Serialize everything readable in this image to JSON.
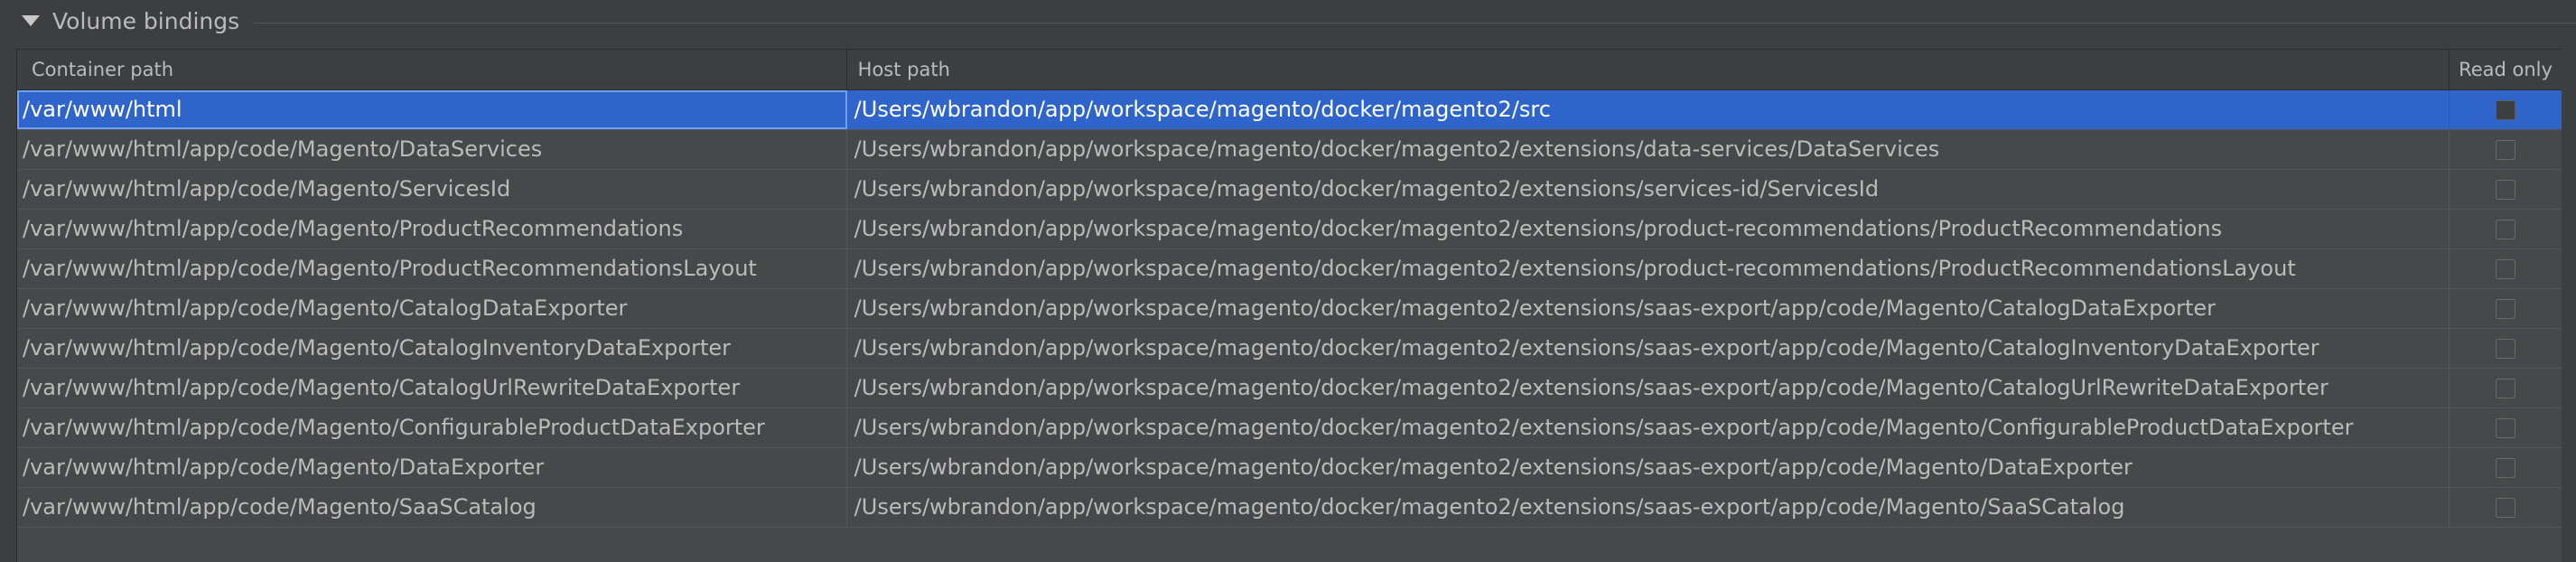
{
  "section": {
    "title": "Volume bindings",
    "toggle_icon": "triangle-down-icon"
  },
  "table": {
    "headers": {
      "container_path": "Container path",
      "host_path": "Host path",
      "read_only": "Read only"
    },
    "rows": [
      {
        "container": "/var/www/html",
        "host": "/Users/wbrandon/app/workspace/magento/docker/magento2/src",
        "read_only": false,
        "selected": true
      },
      {
        "container": "/var/www/html/app/code/Magento/DataServices",
        "host": "/Users/wbrandon/app/workspace/magento/docker/magento2/extensions/data-services/DataServices",
        "read_only": false
      },
      {
        "container": "/var/www/html/app/code/Magento/ServicesId",
        "host": "/Users/wbrandon/app/workspace/magento/docker/magento2/extensions/services-id/ServicesId",
        "read_only": false
      },
      {
        "container": "/var/www/html/app/code/Magento/ProductRecommendations",
        "host": "/Users/wbrandon/app/workspace/magento/docker/magento2/extensions/product-recommendations/ProductRecommendations",
        "read_only": false
      },
      {
        "container": "/var/www/html/app/code/Magento/ProductRecommendationsLayout",
        "host": "/Users/wbrandon/app/workspace/magento/docker/magento2/extensions/product-recommendations/ProductRecommendationsLayout",
        "read_only": false
      },
      {
        "container": "/var/www/html/app/code/Magento/CatalogDataExporter",
        "host": "/Users/wbrandon/app/workspace/magento/docker/magento2/extensions/saas-export/app/code/Magento/CatalogDataExporter",
        "read_only": false
      },
      {
        "container": "/var/www/html/app/code/Magento/CatalogInventoryDataExporter",
        "host": "/Users/wbrandon/app/workspace/magento/docker/magento2/extensions/saas-export/app/code/Magento/CatalogInventoryDataExporter",
        "read_only": false
      },
      {
        "container": "/var/www/html/app/code/Magento/CatalogUrlRewriteDataExporter",
        "host": "/Users/wbrandon/app/workspace/magento/docker/magento2/extensions/saas-export/app/code/Magento/CatalogUrlRewriteDataExporter",
        "read_only": false
      },
      {
        "container": "/var/www/html/app/code/Magento/ConfigurableProductDataExporter",
        "host": "/Users/wbrandon/app/workspace/magento/docker/magento2/extensions/saas-export/app/code/Magento/ConfigurableProductDataExporter",
        "read_only": false
      },
      {
        "container": "/var/www/html/app/code/Magento/DataExporter",
        "host": "/Users/wbrandon/app/workspace/magento/docker/magento2/extensions/saas-export/app/code/Magento/DataExporter",
        "read_only": false
      },
      {
        "container": "/var/www/html/app/code/Magento/SaaSCatalog",
        "host": "/Users/wbrandon/app/workspace/magento/docker/magento2/extensions/saas-export/app/code/Magento/SaaSCatalog",
        "read_only": false
      }
    ]
  },
  "colors": {
    "background": "#3c3f41",
    "selection": "#2f65ca",
    "text": "#bbbbbb"
  }
}
